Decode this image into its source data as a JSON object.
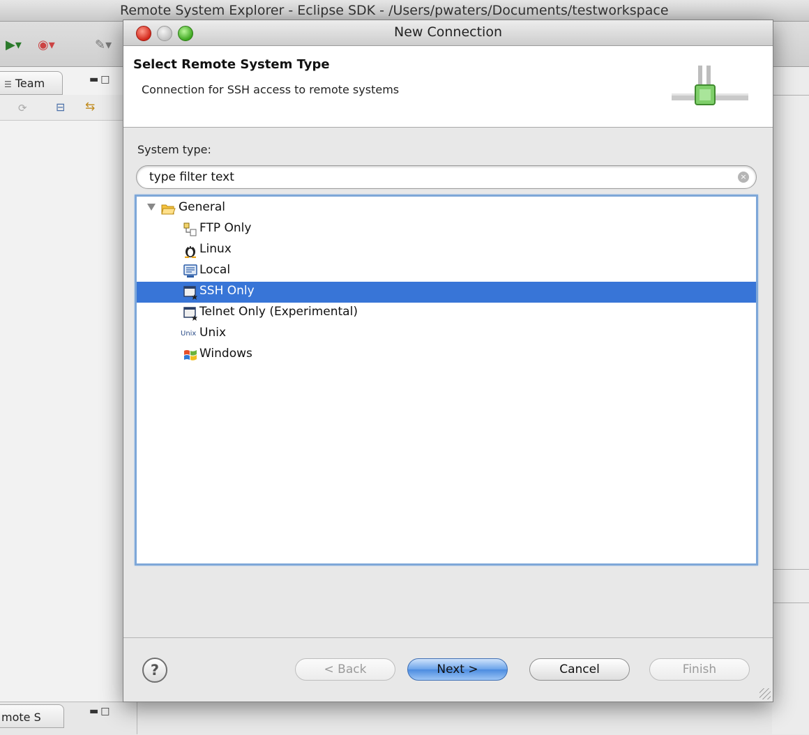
{
  "background_window": {
    "title": "Remote System Explorer - Eclipse SDK - /Users/pwaters/Documents/testworkspace",
    "top_tab_label": "Team",
    "bottom_tab_label": "mote S"
  },
  "dialog": {
    "title": "New Connection",
    "banner": {
      "title": "Select Remote System Type",
      "description": "Connection for SSH access to remote systems"
    },
    "system_type_label": "System type:",
    "filter": {
      "value": "type filter text",
      "placeholder": "type filter text"
    },
    "tree": {
      "group": {
        "label": "General",
        "icon": "folder-open-icon",
        "expanded": true
      },
      "items": [
        {
          "label": "FTP Only",
          "icon": "ftp-icon",
          "selected": false
        },
        {
          "label": "Linux",
          "icon": "linux-penguin-icon",
          "selected": false
        },
        {
          "label": "Local",
          "icon": "local-monitor-icon",
          "selected": false
        },
        {
          "label": "SSH Only",
          "icon": "ssh-terminal-icon",
          "selected": true
        },
        {
          "label": "Telnet Only (Experimental)",
          "icon": "telnet-terminal-icon",
          "selected": false
        },
        {
          "label": "Unix",
          "icon": "unix-text-icon",
          "icon_text": "Unix",
          "selected": false
        },
        {
          "label": "Windows",
          "icon": "windows-logo-icon",
          "selected": false
        }
      ]
    },
    "buttons": {
      "back": "< Back",
      "next": "Next >",
      "cancel": "Cancel",
      "finish": "Finish"
    }
  },
  "colors": {
    "selection": "#3875d7",
    "tree_focus_border": "#7ea7d8",
    "close_button": "#d2281b",
    "zoom_button": "#3da61f"
  }
}
